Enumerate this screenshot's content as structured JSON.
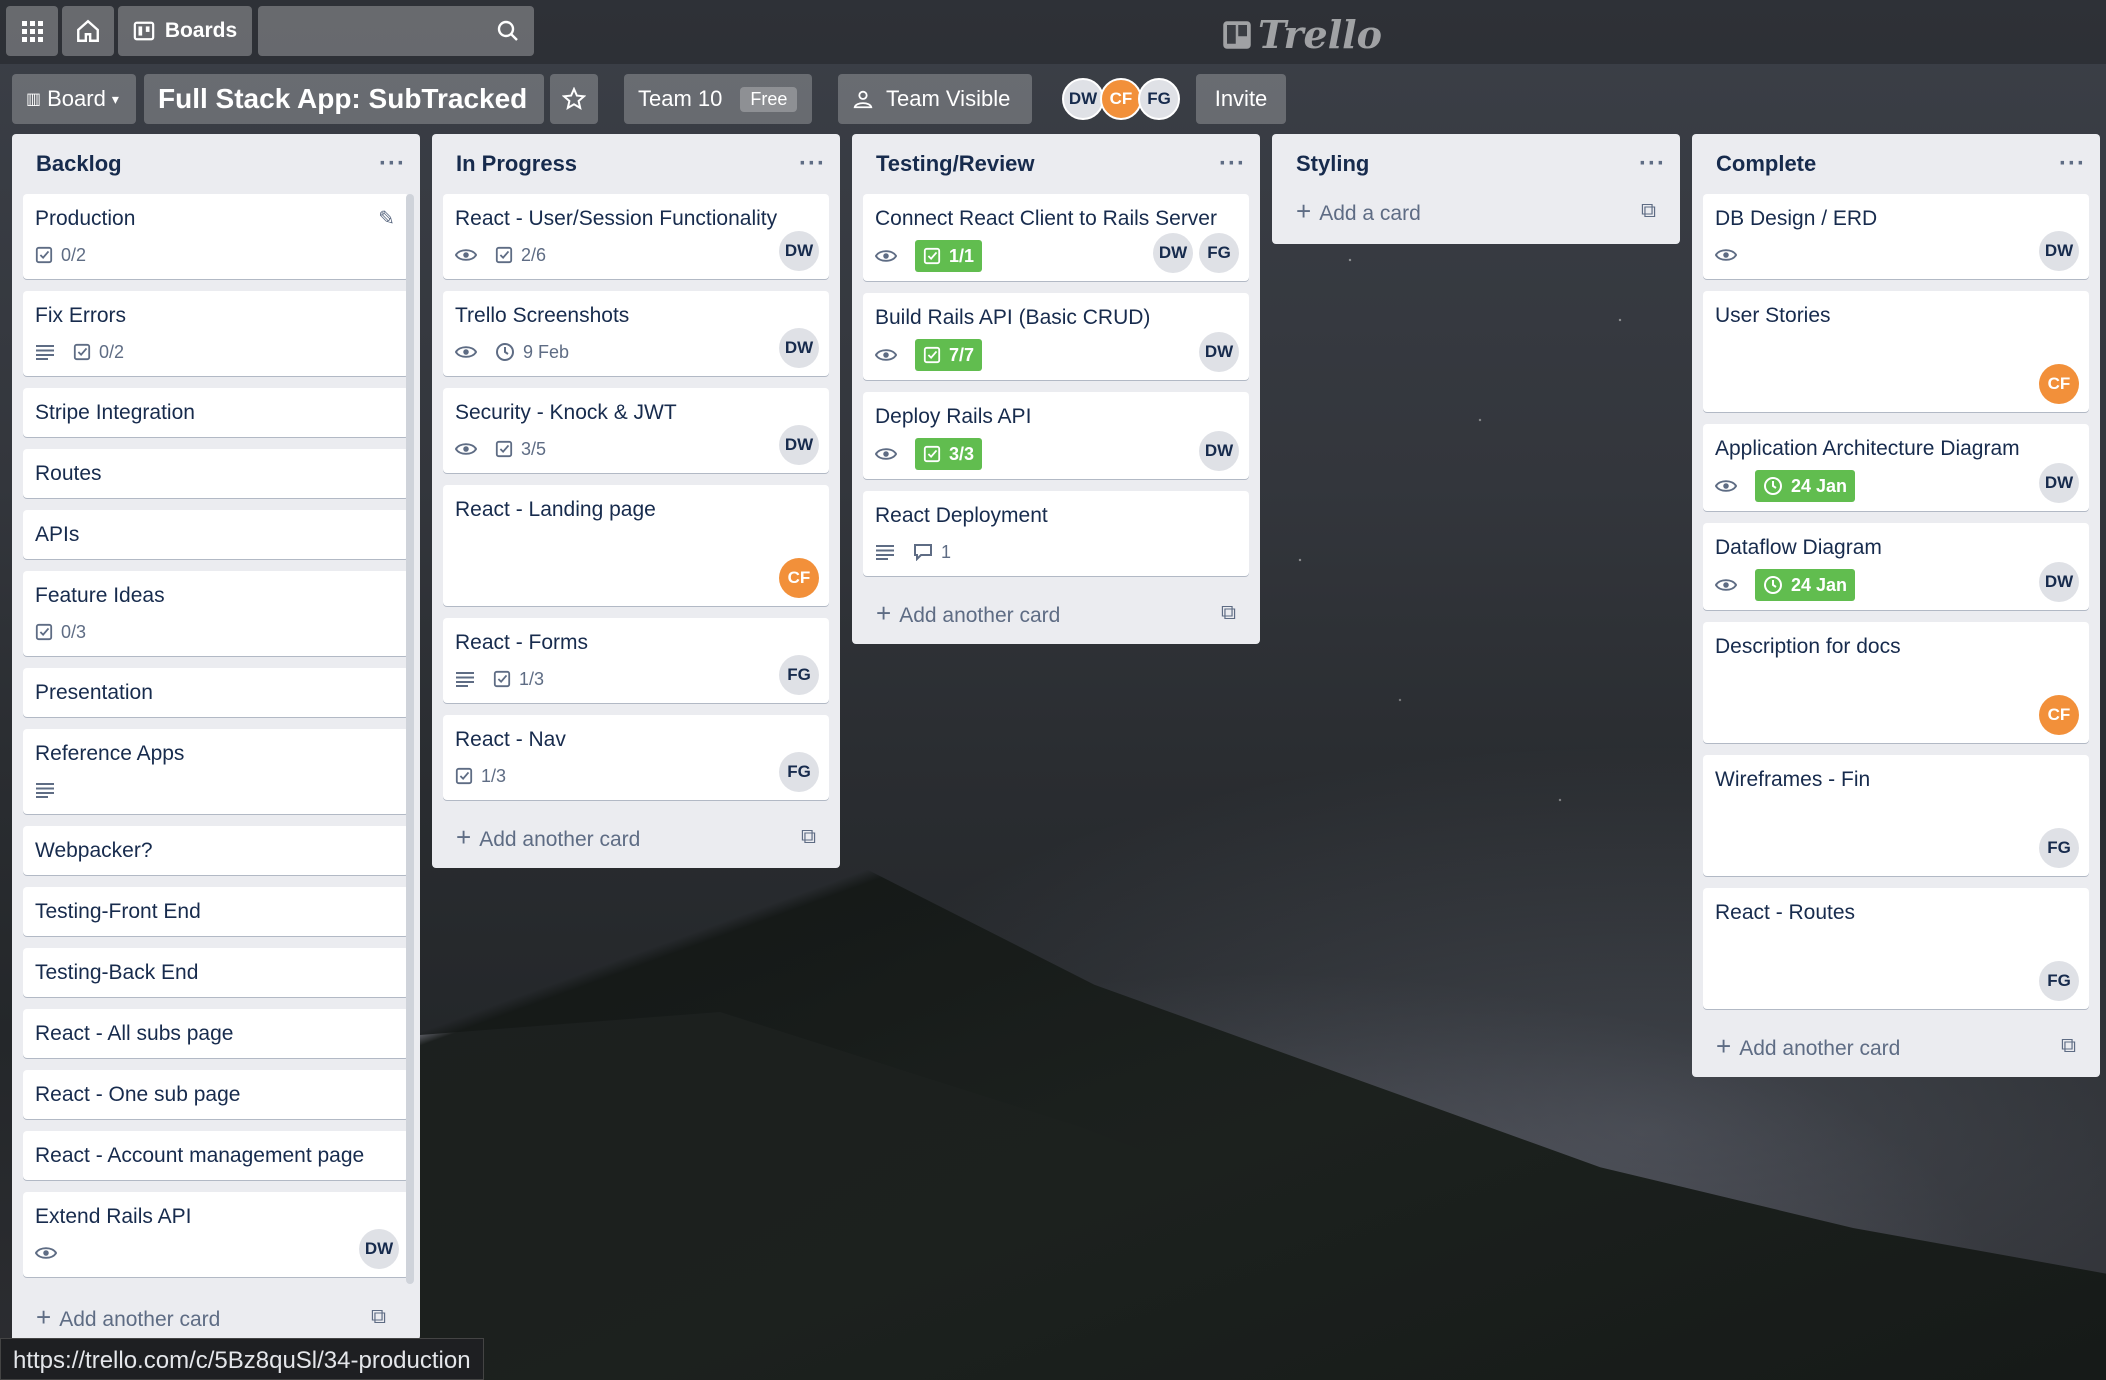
{
  "header": {
    "boards_label": "Boards",
    "logo": "Trello"
  },
  "board_bar": {
    "view_label": "Board",
    "title": "Full Stack App: SubTracked",
    "team": "Team 10",
    "team_plan": "Free",
    "visibility": "Team Visible",
    "members": [
      "DW",
      "CF",
      "FG"
    ],
    "invite": "Invite"
  },
  "lists": [
    {
      "name": "Backlog",
      "add": "Add another card",
      "cards": [
        {
          "title": "Production",
          "badges": [
            {
              "type": "checklist",
              "text": "0/2"
            }
          ],
          "members": []
        },
        {
          "title": "Fix Errors",
          "badges": [
            {
              "type": "description",
              "text": ""
            },
            {
              "type": "checklist",
              "text": "0/2"
            }
          ],
          "members": []
        },
        {
          "title": "Stripe Integration",
          "badges": [],
          "members": []
        },
        {
          "title": "Routes",
          "badges": [],
          "members": []
        },
        {
          "title": "APIs",
          "badges": [],
          "members": []
        },
        {
          "title": "Feature Ideas",
          "badges": [
            {
              "type": "checklist",
              "text": "0/3"
            }
          ],
          "members": []
        },
        {
          "title": "Presentation",
          "badges": [],
          "members": []
        },
        {
          "title": "Reference Apps",
          "badges": [
            {
              "type": "description",
              "text": ""
            }
          ],
          "members": []
        },
        {
          "title": "Webpacker?",
          "badges": [],
          "members": []
        },
        {
          "title": "Testing-Front End",
          "badges": [],
          "members": []
        },
        {
          "title": "Testing-Back End",
          "badges": [],
          "members": []
        },
        {
          "title": "React - All subs page",
          "badges": [],
          "members": []
        },
        {
          "title": "React - One sub page",
          "badges": [],
          "members": []
        },
        {
          "title": "React - Account management page",
          "badges": [],
          "members": []
        },
        {
          "title": "Extend Rails API",
          "badges": [
            {
              "type": "watch",
              "text": ""
            }
          ],
          "members": [
            "DW"
          ]
        }
      ]
    },
    {
      "name": "In Progress",
      "add": "Add another card",
      "cards": [
        {
          "title": "React - User/Session Functionality",
          "badges": [
            {
              "type": "watch",
              "text": ""
            },
            {
              "type": "checklist",
              "text": "2/6"
            }
          ],
          "members": [
            "DW"
          ]
        },
        {
          "title": "Trello Screenshots",
          "badges": [
            {
              "type": "watch",
              "text": ""
            },
            {
              "type": "due",
              "text": "9 Feb"
            }
          ],
          "members": [
            "DW"
          ]
        },
        {
          "title": "Security - Knock & JWT",
          "badges": [
            {
              "type": "watch",
              "text": ""
            },
            {
              "type": "checklist",
              "text": "3/5"
            }
          ],
          "members": [
            "DW"
          ]
        },
        {
          "title": "React - Landing page",
          "badges": [],
          "members": [
            "CF"
          ]
        },
        {
          "title": "React - Forms",
          "badges": [
            {
              "type": "description",
              "text": ""
            },
            {
              "type": "checklist",
              "text": "1/3"
            }
          ],
          "members": [
            "FG"
          ]
        },
        {
          "title": "React - Nav",
          "badges": [
            {
              "type": "checklist",
              "text": "1/3"
            }
          ],
          "members": [
            "FG"
          ]
        }
      ]
    },
    {
      "name": "Testing/Review",
      "add": "Add another card",
      "cards": [
        {
          "title": "Connect React Client to Rails Server",
          "badges": [
            {
              "type": "watch",
              "text": ""
            },
            {
              "type": "checklist-done",
              "text": "1/1"
            }
          ],
          "members": [
            "DW",
            "FG"
          ]
        },
        {
          "title": "Build Rails API (Basic CRUD)",
          "badges": [
            {
              "type": "watch",
              "text": ""
            },
            {
              "type": "checklist-done",
              "text": "7/7"
            }
          ],
          "members": [
            "DW"
          ]
        },
        {
          "title": "Deploy Rails API",
          "badges": [
            {
              "type": "watch",
              "text": ""
            },
            {
              "type": "checklist-done",
              "text": "3/3"
            }
          ],
          "members": [
            "DW"
          ]
        },
        {
          "title": "React Deployment",
          "badges": [
            {
              "type": "description",
              "text": ""
            },
            {
              "type": "comment",
              "text": "1"
            }
          ],
          "members": []
        }
      ]
    },
    {
      "name": "Styling",
      "add": "Add a card",
      "cards": []
    },
    {
      "name": "Complete",
      "add": "Add another card",
      "cards": [
        {
          "title": "DB Design / ERD",
          "badges": [
            {
              "type": "watch",
              "text": ""
            }
          ],
          "members": [
            "DW"
          ]
        },
        {
          "title": "User Stories",
          "badges": [],
          "members": [
            "CF"
          ]
        },
        {
          "title": "Application Architecture Diagram",
          "badges": [
            {
              "type": "watch",
              "text": ""
            },
            {
              "type": "due-done",
              "text": "24 Jan"
            }
          ],
          "members": [
            "DW"
          ]
        },
        {
          "title": "Dataflow Diagram",
          "badges": [
            {
              "type": "watch",
              "text": ""
            },
            {
              "type": "due-done",
              "text": "24 Jan"
            }
          ],
          "members": [
            "DW"
          ]
        },
        {
          "title": "Description for docs",
          "badges": [],
          "members": [
            "CF"
          ]
        },
        {
          "title": "Wireframes - Fin",
          "badges": [],
          "members": [
            "FG"
          ]
        },
        {
          "title": "React - Routes",
          "badges": [],
          "members": [
            "FG"
          ]
        }
      ]
    }
  ],
  "status_url": "https://trello.com/c/5Bz8quSl/34-production",
  "colors": {
    "accent_orange": "#f2903a",
    "label_green": "#61bd4f",
    "list_bg": "#ebecf0"
  }
}
